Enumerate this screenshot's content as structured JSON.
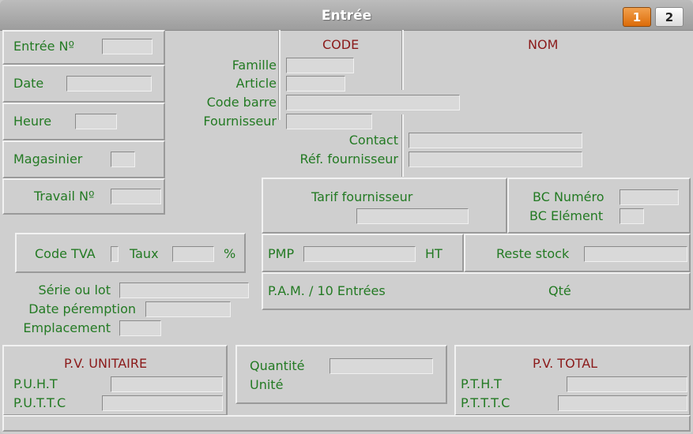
{
  "window": {
    "title": "Entrée",
    "pages": [
      "1",
      "2"
    ]
  },
  "left": {
    "entree_no": "Entrée Nº",
    "date": "Date",
    "heure": "Heure",
    "magasinier": "Magasinier",
    "travail_no": "Travail Nº"
  },
  "product": {
    "code_header": "CODE",
    "nom_header": "NOM",
    "famille": "Famille",
    "article": "Article",
    "code_barre": "Code barre",
    "fournisseur": "Fournisseur",
    "contact": "Contact",
    "ref_fournisseur": "Réf. fournisseur"
  },
  "tarif": {
    "label": "Tarif fournisseur"
  },
  "bc": {
    "numero": "BC Numéro",
    "element": "BC Elément"
  },
  "tva": {
    "code": "Code TVA",
    "taux": "Taux",
    "percent": "%"
  },
  "pmp": {
    "label": "PMP",
    "ht": "HT"
  },
  "stock": {
    "reste": "Reste stock"
  },
  "pam": {
    "label": "P.A.M. / 10 Entrées",
    "qte": "Qté"
  },
  "lot": {
    "serie": "Série ou lot",
    "peremption": "Date péremption",
    "emplacement": "Emplacement"
  },
  "pv_unit": {
    "header": "P.V. UNITAIRE",
    "puht": "P.U.H.T",
    "puttc": "P.U.T.T.C"
  },
  "quantite": {
    "quantite": "Quantité",
    "unite": "Unité"
  },
  "pv_total": {
    "header": "P.V. TOTAL",
    "ptht": "P.T.H.T",
    "ptttc": "P.T.T.T.C"
  }
}
